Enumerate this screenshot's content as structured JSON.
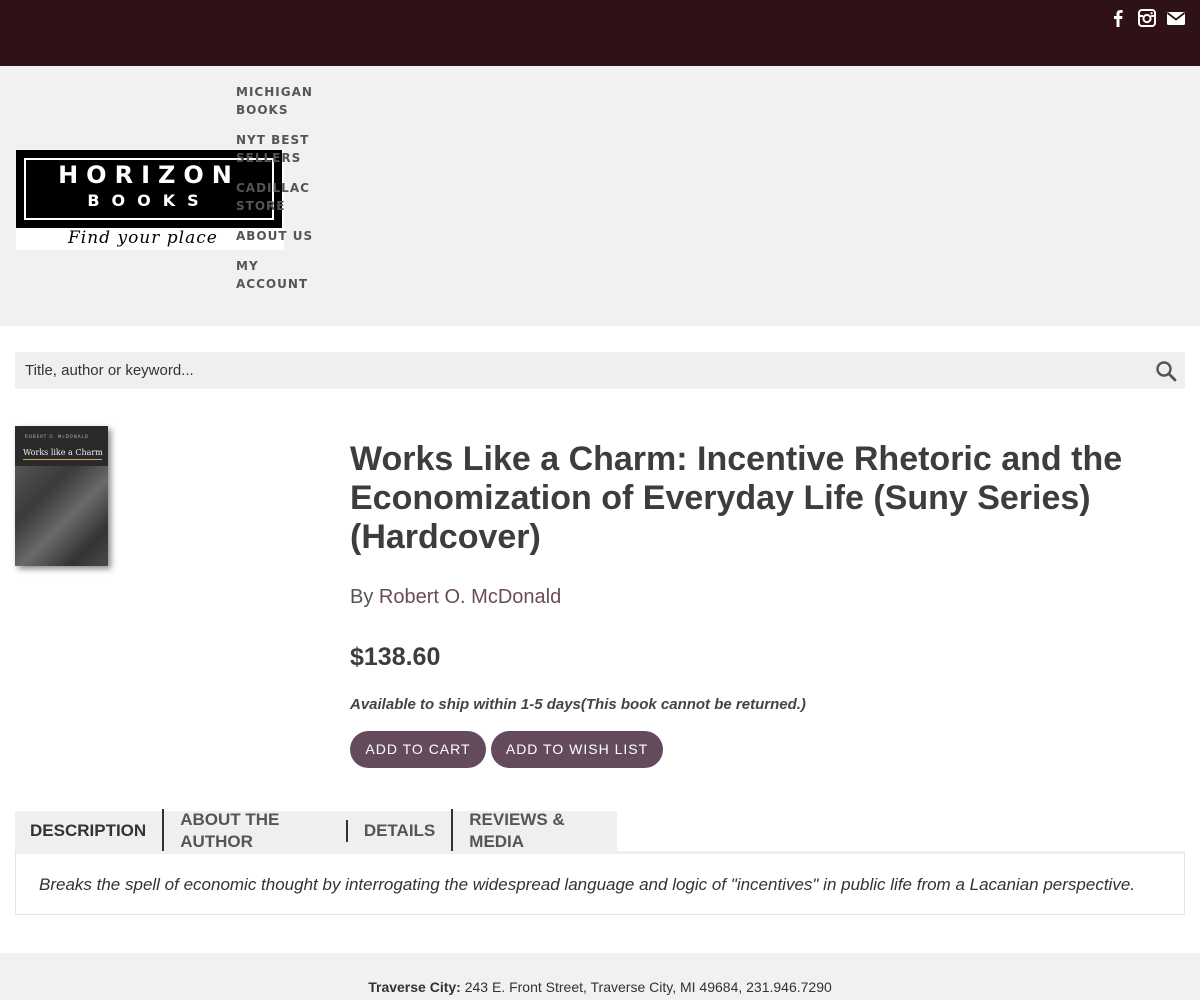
{
  "social": {
    "facebook": "facebook-icon",
    "instagram": "instagram-icon",
    "email": "email-icon"
  },
  "logo": {
    "line1": "HORIZON",
    "line2": "BOOKS",
    "tagline": "Find your place"
  },
  "nav": {
    "items": [
      {
        "label": "MICHIGAN BOOKS"
      },
      {
        "label": "NYT BEST SELLERS"
      },
      {
        "label": "CADILLAC STORE"
      },
      {
        "label": "ABOUT US"
      },
      {
        "label": "MY ACCOUNT"
      }
    ]
  },
  "search": {
    "placeholder": "Title, author or keyword..."
  },
  "book": {
    "cover_author": "ROBERT O. McDONALD",
    "cover_title": "Works like a Charm",
    "title": "Works Like a Charm: Incentive Rhetoric and the Economization of Everyday Life (Suny Series) (Hardcover)",
    "by_prefix": "By ",
    "author": "Robert O. McDonald",
    "price": "$138.60",
    "availability": "Available to ship within 1-5 days(This book cannot be returned.)"
  },
  "actions": {
    "add_to_cart": "ADD TO CART",
    "add_to_wish_list": "ADD TO WISH LIST"
  },
  "tabs": [
    {
      "label": "DESCRIPTION"
    },
    {
      "label": "ABOUT THE AUTHOR"
    },
    {
      "label": "DETAILS"
    },
    {
      "label": "REVIEWS & MEDIA"
    }
  ],
  "description": "Breaks the spell of economic thought by interrogating the widespread language and logic of \"incentives\" in public life from a Lacanian perspective.",
  "footer": {
    "location": "Traverse City:",
    "address": " 243 E. Front Street, Traverse City, MI 49684, 231.946.7290"
  },
  "colors": {
    "topbar": "#2e1216",
    "accent": "#634a5d",
    "link": "#6b4a5c"
  }
}
